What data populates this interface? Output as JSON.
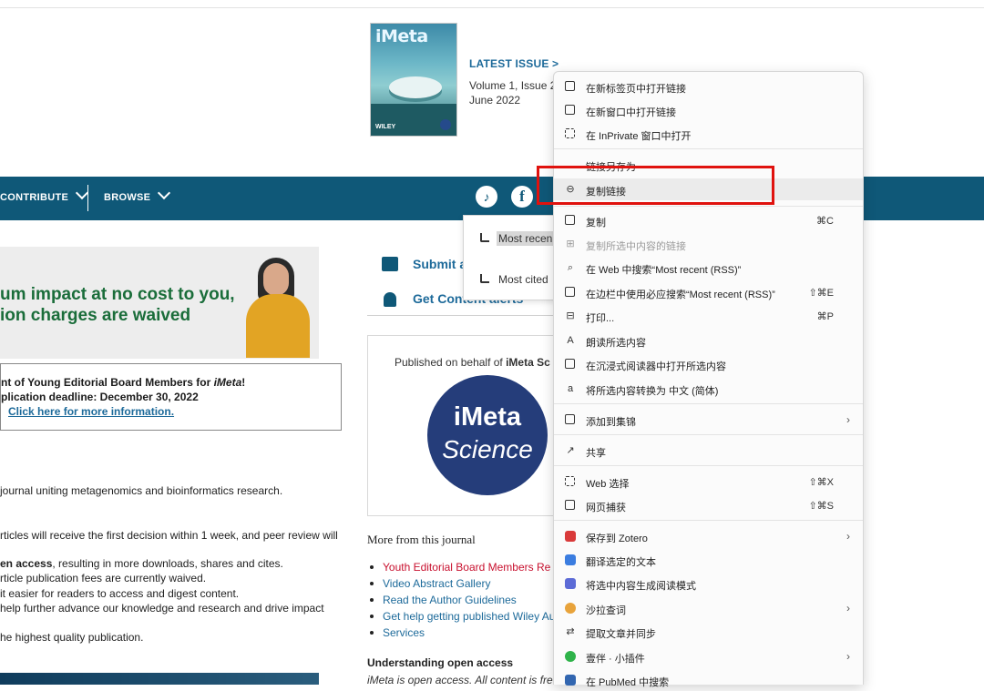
{
  "issue": {
    "latest": "LATEST ISSUE >",
    "volume": "Volume 1, Issue 2",
    "date": "June 2022",
    "cover_title": "iMeta",
    "publisher": "WILEY"
  },
  "nav": {
    "contribute": "CONTRIBUTE",
    "browse": "BROWSE"
  },
  "banner": {
    "line1": "um impact at no cost to you,",
    "line2": "ion charges are waived"
  },
  "editorial": {
    "line1_prefix": "nt of Young Editorial Board Members for ",
    "line1_em": "iMeta",
    "line1_suffix": "!",
    "line2": "plication deadline: December 30, 2022",
    "link": "Click here for more information."
  },
  "about": {
    "p1": "journal uniting metagenomics and bioinformatics research.",
    "p2": "rticles will receive the first decision within 1 week, and peer review will",
    "p3_bold": "en access",
    "p3_rest": ", resulting in more downloads, shares and cites.",
    "p4": "rticle publication fees are currently waived.",
    "p5": "it easier for readers to access and digest content.",
    "p6": " help further advance our knowledge and research and drive impact",
    "p7": "he highest quality publication."
  },
  "sidebar": {
    "submit": "Submit a",
    "alerts": "Get Content alerts"
  },
  "feeds": {
    "recent": "Most recen",
    "cited": "Most cited"
  },
  "published": {
    "prefix": "Published on behalf of ",
    "org": "iMeta Sc",
    "logo_top": "iMeta",
    "logo_bottom": "Science"
  },
  "more": {
    "heading": "More from this journal",
    "items": [
      "Youth Editorial Board Members Re",
      "Video Abstract Gallery",
      "Read the Author Guidelines",
      "Get help getting published Wiley Au",
      "Services"
    ],
    "understanding": "Understanding open access",
    "imopen": "iMeta is open access. All content is free"
  },
  "context_menu": {
    "items": [
      {
        "label": "在新标签页中打开链接",
        "shortcut": ""
      },
      {
        "label": "在新窗口中打开链接",
        "shortcut": ""
      },
      {
        "label": "在 InPrivate 窗口中打开",
        "shortcut": ""
      },
      {
        "label": "链接另存为",
        "shortcut": ""
      },
      {
        "label": "复制链接",
        "shortcut": ""
      },
      {
        "label": "复制",
        "shortcut": "⌘C"
      },
      {
        "label": "复制所选中内容的链接",
        "shortcut": ""
      },
      {
        "label": "在 Web 中搜索“Most recent (RSS)”",
        "shortcut": ""
      },
      {
        "label": "在边栏中使用必应搜索“Most recent (RSS)”",
        "shortcut": "⇧⌘E"
      },
      {
        "label": "打印...",
        "shortcut": "⌘P"
      },
      {
        "label": "朗读所选内容",
        "shortcut": ""
      },
      {
        "label": "在沉浸式阅读器中打开所选内容",
        "shortcut": ""
      },
      {
        "label": "将所选内容转换为 中文 (简体)",
        "shortcut": ""
      },
      {
        "label": "添加到集锦",
        "shortcut": ""
      },
      {
        "label": "共享",
        "shortcut": ""
      },
      {
        "label": "Web 选择",
        "shortcut": "⇧⌘X"
      },
      {
        "label": "网页捕获",
        "shortcut": "⇧⌘S"
      },
      {
        "label": "保存到 Zotero",
        "shortcut": ""
      },
      {
        "label": "翻译选定的文本",
        "shortcut": ""
      },
      {
        "label": "将选中内容生成阅读模式",
        "shortcut": ""
      },
      {
        "label": "沙拉查词",
        "shortcut": ""
      },
      {
        "label": "提取文章并同步",
        "shortcut": ""
      },
      {
        "label": "壹伴 · 小插件",
        "shortcut": ""
      },
      {
        "label": "在 PubMed 中搜索",
        "shortcut": ""
      }
    ],
    "highlighted": "复制链接",
    "colors": {
      "highlight_box": "#e0120e",
      "nav": "#0f5878"
    }
  }
}
